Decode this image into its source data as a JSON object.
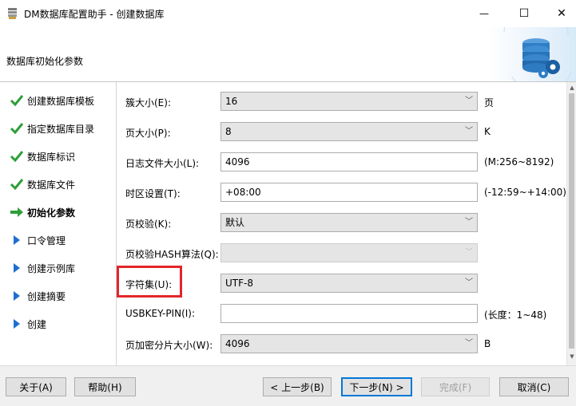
{
  "window": {
    "title": "DM数据库配置助手 - 创建数据库",
    "minimize_glyph": "—",
    "maximize_glyph": "☐",
    "close_glyph": "✕"
  },
  "header": {
    "title": "数据库初始化参数"
  },
  "steps": [
    {
      "label": "创建数据库模板",
      "state": "done"
    },
    {
      "label": "指定数据库目录",
      "state": "done"
    },
    {
      "label": "数据库标识",
      "state": "done"
    },
    {
      "label": "数据库文件",
      "state": "done"
    },
    {
      "label": "初始化参数",
      "state": "current"
    },
    {
      "label": "口令管理",
      "state": "pending"
    },
    {
      "label": "创建示例库",
      "state": "pending"
    },
    {
      "label": "创建摘要",
      "state": "pending"
    },
    {
      "label": "创建",
      "state": "pending"
    }
  ],
  "form": {
    "extent_size": {
      "label": "簇大小(E):",
      "value": "16",
      "unit": "页"
    },
    "page_size": {
      "label": "页大小(P):",
      "value": "8",
      "unit": "K"
    },
    "log_size": {
      "label": "日志文件大小(L):",
      "value": "4096",
      "unit": "(M:256~8192)"
    },
    "time_zone": {
      "label": "时区设置(T):",
      "value": "+08:00",
      "unit": "(-12:59~+14:00)"
    },
    "page_check": {
      "label": "页校验(K):",
      "value": "默认"
    },
    "page_hash": {
      "label": "页校验HASH算法(Q):",
      "value": ""
    },
    "charset": {
      "label": "字符集(U):",
      "value": "UTF-8"
    },
    "usbkey_pin": {
      "label": "USBKEY-PIN(I):",
      "value": "",
      "unit": "(长度：1~48)"
    },
    "page_enc_slice": {
      "label": "页加密分片大小(W):",
      "value": "4096",
      "unit": "B"
    }
  },
  "buttons": {
    "about": "关于(A)",
    "help": "帮助(H)",
    "prev": "< 上一步(B)",
    "next": "下一步(N) >",
    "finish": "完成(F)",
    "cancel": "取消(C)"
  },
  "colors": {
    "done_check": "#2e9e3a",
    "current_arrow": "#2e9e3a",
    "pending_triangle": "#1f6fd0",
    "highlight_box": "#e3262a",
    "default_button_border": "#0078d7"
  }
}
